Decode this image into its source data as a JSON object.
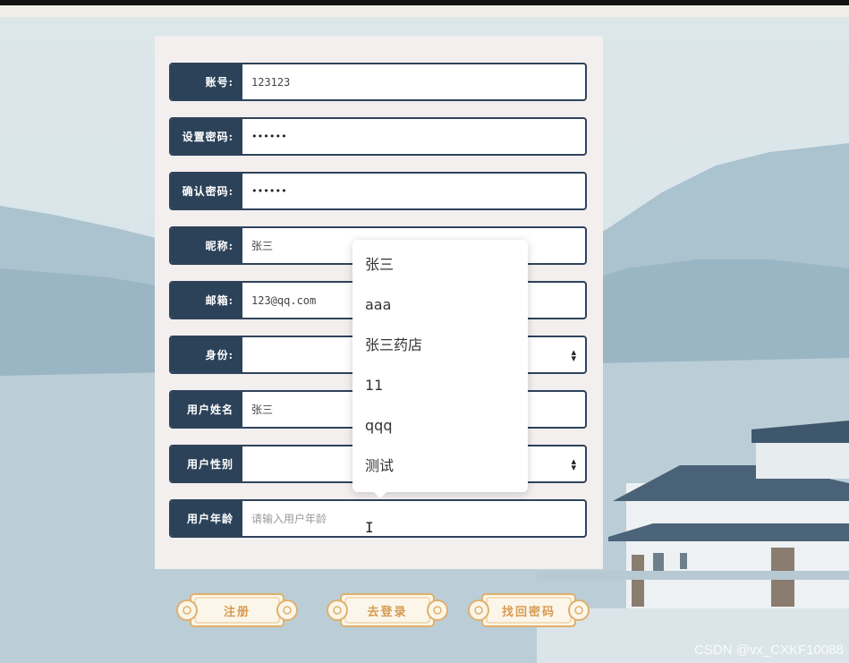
{
  "form": {
    "rows": [
      {
        "label": "账号:",
        "value": "123123",
        "placeholder": ""
      },
      {
        "label": "设置密码:",
        "value": "••••••",
        "placeholder": ""
      },
      {
        "label": "确认密码:",
        "value": "••••••",
        "placeholder": ""
      },
      {
        "label": "昵称:",
        "value": "张三",
        "placeholder": ""
      },
      {
        "label": "邮箱:",
        "value": "123@qq.com",
        "placeholder": ""
      },
      {
        "label": "身份:",
        "value": "",
        "placeholder": ""
      },
      {
        "label": "用户姓名",
        "value": "张三",
        "placeholder": ""
      },
      {
        "label": "用户性别",
        "value": "",
        "placeholder": ""
      },
      {
        "label": "用户年龄",
        "value": "",
        "placeholder": "请输入用户年龄"
      }
    ]
  },
  "autocomplete": {
    "options": [
      "张三",
      "aaa",
      "张三药店",
      "11",
      "qqq",
      "测试"
    ]
  },
  "buttons": {
    "register": "注册",
    "login": "去登录",
    "recover": "找回密码"
  },
  "colors": {
    "label_bg": "#2c4259",
    "border": "#2e435a",
    "button_text": "#d79a52"
  },
  "watermark": "CSDN @vx_CXKF10088"
}
